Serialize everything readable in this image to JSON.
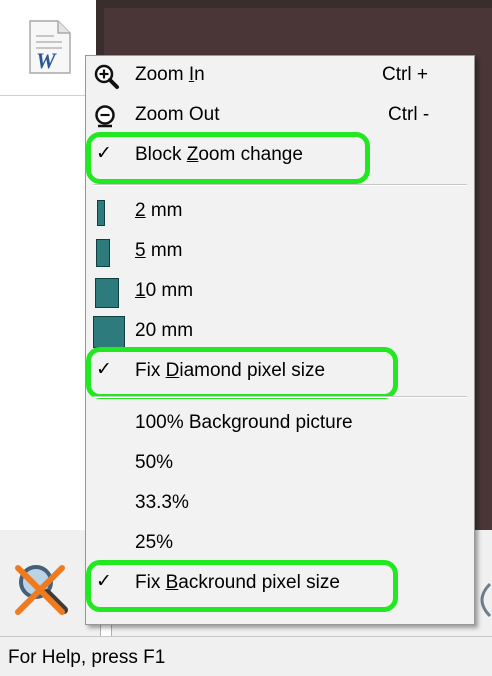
{
  "status_bar": {
    "text": "For Help, press F1"
  },
  "doc_icon": {
    "letter": "W"
  },
  "menu": {
    "zoom_in": {
      "label_pre": "Zoom ",
      "label_mn": "I",
      "label_post": "n",
      "shortcut": "Ctrl +",
      "icon": "zoom-in-icon"
    },
    "zoom_out": {
      "label": "Zoom Out",
      "shortcut": "Ctrl -",
      "icon": "zoom-out-icon"
    },
    "block_zoom": {
      "check": "✓",
      "label_pre": "Block ",
      "label_mn": "Z",
      "label_post": "oom change",
      "checked": true
    },
    "sizes": [
      {
        "mn": "2",
        "rest": " mm"
      },
      {
        "mn": "5",
        "rest": " mm"
      },
      {
        "mn": "1",
        "rest": "0 mm"
      },
      {
        "mn": "",
        "rest": "20 mm"
      }
    ],
    "fix_diamond": {
      "check": "✓",
      "label_pre": "Fix ",
      "label_mn": "D",
      "label_post": "iamond pixel size",
      "checked": true
    },
    "bg_options": [
      "100% Background picture",
      "50%",
      "33.3%",
      "25%"
    ],
    "fix_background": {
      "check": "✓",
      "label_pre": "Fix ",
      "label_mn": "B",
      "label_post": "ackround pixel size",
      "checked": true
    }
  },
  "colors": {
    "highlight": "#22e822",
    "swatch": "#2e7b7d"
  }
}
